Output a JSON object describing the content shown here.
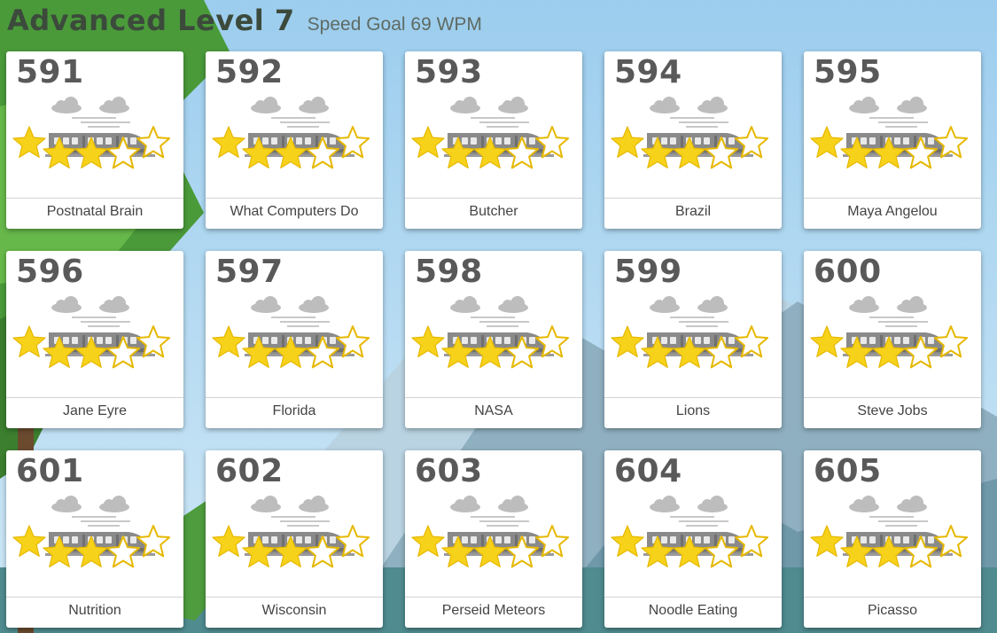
{
  "header": {
    "title": "Advanced Level 7",
    "goal": "Speed Goal 69 WPM"
  },
  "levels": [
    {
      "number": "591",
      "name": "Postnatal Brain",
      "stars": 3
    },
    {
      "number": "592",
      "name": "What Computers Do",
      "stars": 3
    },
    {
      "number": "593",
      "name": "Butcher",
      "stars": 3
    },
    {
      "number": "594",
      "name": "Brazil",
      "stars": 3
    },
    {
      "number": "595",
      "name": "Maya Angelou",
      "stars": 3
    },
    {
      "number": "596",
      "name": "Jane Eyre",
      "stars": 3
    },
    {
      "number": "597",
      "name": "Florida",
      "stars": 3
    },
    {
      "number": "598",
      "name": "NASA",
      "stars": 3
    },
    {
      "number": "599",
      "name": "Lions",
      "stars": 3
    },
    {
      "number": "600",
      "name": "Steve Jobs",
      "stars": 3
    },
    {
      "number": "601",
      "name": "Nutrition",
      "stars": 3
    },
    {
      "number": "602",
      "name": "Wisconsin",
      "stars": 3
    },
    {
      "number": "603",
      "name": "Perseid Meteors",
      "stars": 3
    },
    {
      "number": "604",
      "name": "Noodle Eating",
      "stars": 3
    },
    {
      "number": "605",
      "name": "Picasso",
      "stars": 3
    }
  ],
  "stars_total": 5,
  "colors": {
    "star_filled": "#f7d21a",
    "star_outline": "#e6b800",
    "train": "#8a8a8a",
    "cloud": "#bdbdbd"
  },
  "icons": {
    "card_art": "train-icon",
    "clouds": "cloud-icon",
    "rating": "star-icon"
  }
}
